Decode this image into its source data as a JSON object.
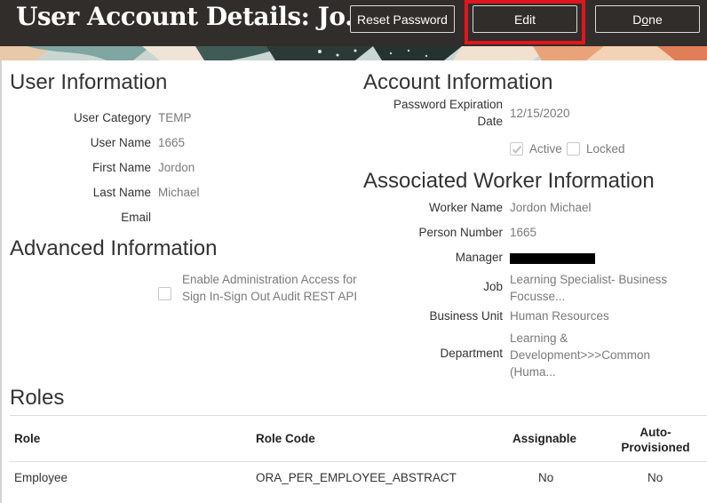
{
  "header": {
    "title": "User Account Details: Jo...",
    "reset_label": "Reset Password",
    "edit_label": "Edit",
    "done_label": "Done",
    "done_mnemonic": "o",
    "highlight_color": "#e0161c"
  },
  "user_info": {
    "title": "User Information",
    "fields": [
      {
        "label": "User Category",
        "value": "TEMP"
      },
      {
        "label": "User Name",
        "value": "1665"
      },
      {
        "label": "First Name",
        "value": "Jordon"
      },
      {
        "label": "Last Name",
        "value": "Michael"
      },
      {
        "label": "Email",
        "value": ""
      }
    ]
  },
  "advanced_info": {
    "title": "Advanced Information",
    "admin_access_label": "Enable Administration Access for Sign In-Sign Out Audit REST API",
    "admin_access_checked": false
  },
  "account_info": {
    "title": "Account Information",
    "password_exp_label": "Password Expiration Date",
    "password_exp_label_1": "Password Expiration",
    "password_exp_label_2": "Date",
    "password_exp_value": "12/15/2020",
    "active_label": "Active",
    "active_checked": true,
    "locked_label": "Locked",
    "locked_checked": false
  },
  "worker_info": {
    "title": "Associated Worker Information",
    "worker_name_label": "Worker Name",
    "worker_name_value": "Jordon Michael",
    "person_number_label": "Person Number",
    "person_number_value": "1665",
    "manager_label": "Manager",
    "job_label": "Job",
    "job_value_1": "Learning Specialist- Business",
    "job_value_2": "Focusse...",
    "business_unit_label": "Business Unit",
    "business_unit_value": "Human Resources",
    "department_label": "Department",
    "department_value_1": "Learning &",
    "department_value_2": "Development>>>Common",
    "department_value_3": "(Huma..."
  },
  "roles": {
    "title": "Roles",
    "columns": [
      "Role",
      "Role Code",
      "Assignable",
      "Auto-Provisioned"
    ],
    "col_auto_1": "Auto-",
    "col_auto_2": "Provisioned",
    "rows": [
      {
        "role": "Employee",
        "code": "ORA_PER_EMPLOYEE_ABSTRACT",
        "assignable": "No",
        "auto": "No"
      }
    ]
  }
}
